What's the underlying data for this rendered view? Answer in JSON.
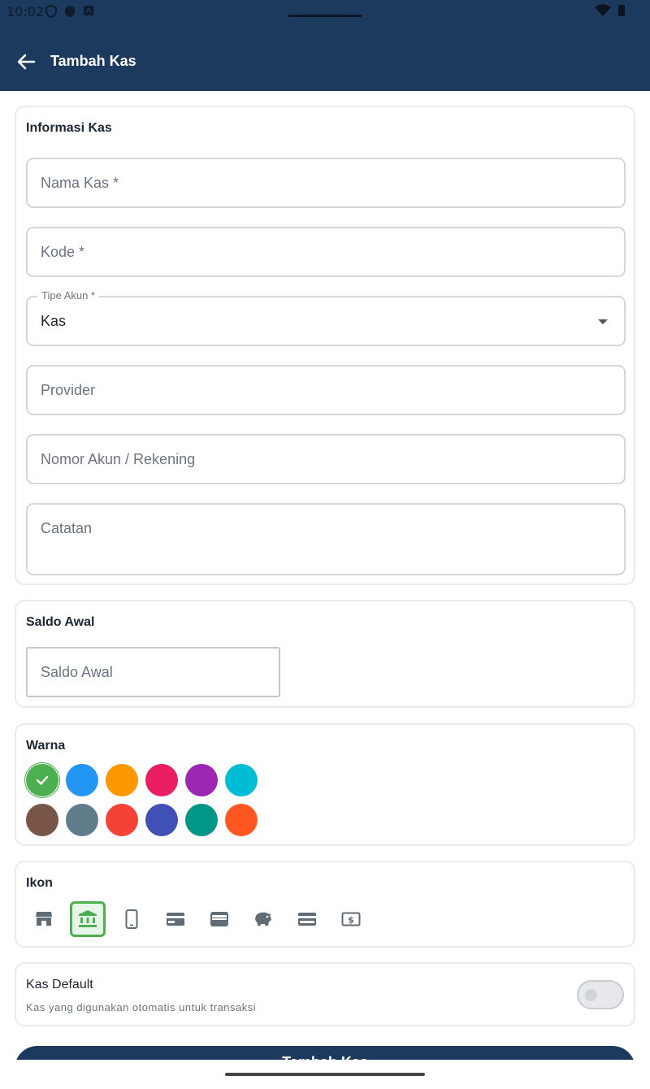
{
  "status": {
    "time": "10:02"
  },
  "appbar": {
    "title": "Tambah Kas"
  },
  "info": {
    "title": "Informasi Kas",
    "nama_kas": "Nama Kas *",
    "kode": "Kode *",
    "tipe_label": "Tipe Akun *",
    "tipe_value": "Kas",
    "provider": "Provider",
    "nomor": "Nomor Akun / Rekening",
    "catatan": "Catatan"
  },
  "saldo": {
    "title": "Saldo Awal",
    "placeholder": "Saldo Awal"
  },
  "warna": {
    "title": "Warna",
    "selected": "#4caf50",
    "colors": [
      "#4caf50",
      "#2196f3",
      "#ff9800",
      "#e91e63",
      "#9c27b0",
      "#00bcd4",
      "#795548",
      "#607d8b",
      "#f44336",
      "#3f51b5",
      "#009688",
      "#ff5722"
    ]
  },
  "ikon": {
    "title": "Ikon",
    "icons": [
      "store-icon",
      "bank-icon",
      "phone-icon",
      "credit-card-icon",
      "wallet-icon",
      "piggy-bank-icon",
      "card-icon",
      "cash-icon"
    ],
    "selected": "bank-icon"
  },
  "default": {
    "title": "Kas Default",
    "subtitle": "Kas yang digunakan otomatis untuk transaksi",
    "enabled": false
  },
  "submit": {
    "label": "Tambah Kas"
  },
  "colors": {
    "primary": "#1b3a5e",
    "accent": "#4caf50",
    "border": "#d3d7dc"
  }
}
